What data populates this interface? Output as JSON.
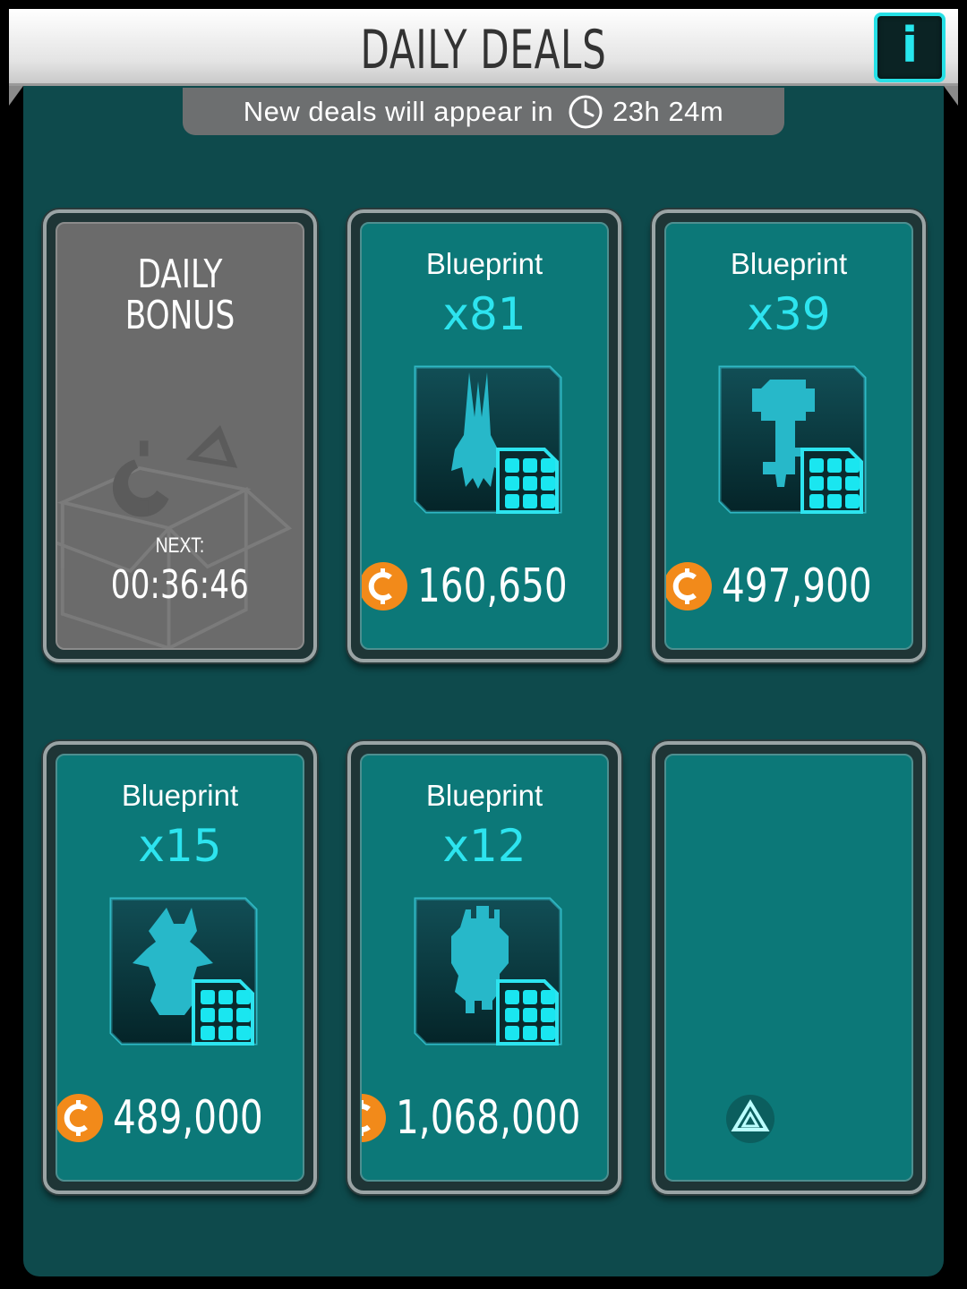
{
  "header": {
    "title": "DAILY DEALS",
    "info_label": "i"
  },
  "timer": {
    "text": "New deals will appear in",
    "remaining": "23h 24m"
  },
  "daily_bonus": {
    "title_line1": "DAILY",
    "title_line2": "BONUS",
    "next_label": "NEXT:",
    "countdown": "00:36:46"
  },
  "deals": [
    {
      "label": "Blueprint",
      "quantity": "x81",
      "price": "160,650",
      "ship": "needle"
    },
    {
      "label": "Blueprint",
      "quantity": "x39",
      "price": "497,900",
      "ship": "tower"
    },
    {
      "label": "Blueprint",
      "quantity": "x15",
      "price": "489,000",
      "ship": "crab"
    },
    {
      "label": "Blueprint",
      "quantity": "x12",
      "price": "1,068,000",
      "ship": "block"
    }
  ],
  "icons": {
    "currency": "credits-coin-icon",
    "grid": "blueprint-grid-icon",
    "clock": "clock-icon",
    "logo": "triangle-logo-icon"
  },
  "colors": {
    "panel": "#0e4a4c",
    "card": "#0c7878",
    "accent": "#2de4ef",
    "coin": "#f28a1a"
  }
}
